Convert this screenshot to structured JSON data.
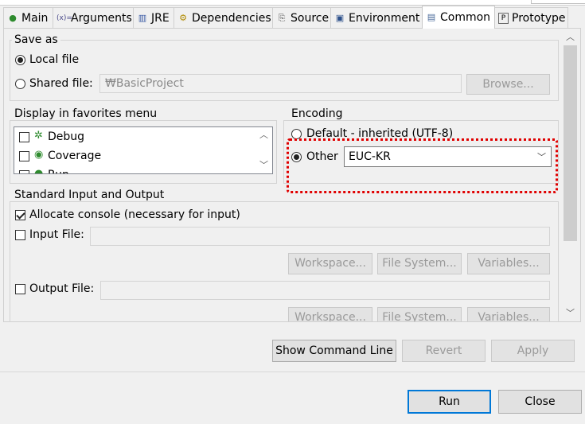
{
  "tabs": [
    {
      "label": "Main",
      "icon": "main-run-icon"
    },
    {
      "label": "Arguments",
      "icon": "arguments-icon"
    },
    {
      "label": "JRE",
      "icon": "jre-icon"
    },
    {
      "label": "Dependencies",
      "icon": "dependencies-icon"
    },
    {
      "label": "Source",
      "icon": "source-icon"
    },
    {
      "label": "Environment",
      "icon": "environment-icon"
    },
    {
      "label": "Common",
      "icon": "common-icon",
      "active": true
    },
    {
      "label": "Prototype",
      "icon": "prototype-icon"
    }
  ],
  "save_as": {
    "title": "Save as",
    "local_file": "Local file",
    "shared_file": "Shared file:",
    "shared_file_value": "₩BasicProject",
    "browse": "Browse..."
  },
  "favorites": {
    "title": "Display in favorites menu",
    "items": [
      "Debug",
      "Coverage",
      "Run"
    ]
  },
  "encoding": {
    "title": "Encoding",
    "default_label": "Default - inherited (UTF-8)",
    "other_label": "Other",
    "other_value": "EUC-KR",
    "highlight_color": "#e00000"
  },
  "std_io": {
    "title": "Standard Input and Output",
    "allocate_console": "Allocate console (necessary for input)",
    "input_file": "Input File:",
    "output_file": "Output File:",
    "workspace": "Workspace...",
    "file_system": "File System...",
    "variables": "Variables..."
  },
  "actions": {
    "show_command_line": "Show Command Line",
    "revert": "Revert",
    "apply": "Apply",
    "run": "Run",
    "close": "Close"
  }
}
